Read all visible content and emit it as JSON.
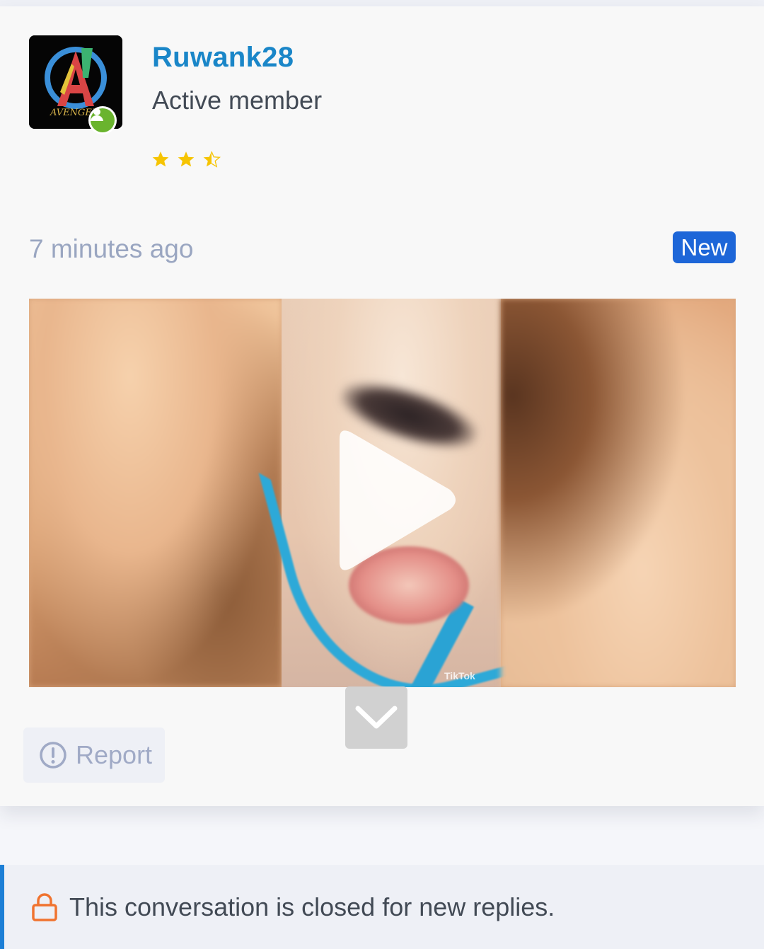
{
  "post": {
    "author": {
      "username": "Ruwank28",
      "user_title": "Active member",
      "online_icon": "user-icon",
      "rating_stars": 2.5,
      "rating_max": 3
    },
    "timestamp": "7 minutes ago",
    "badge": "New",
    "media": {
      "type": "video",
      "watermark": "TikTok",
      "play_icon": "play-icon",
      "collapse_icon": "chevron-down-icon"
    },
    "actions": {
      "report_label": "Report",
      "report_icon": "exclamation-circle-icon"
    }
  },
  "thread_notice": {
    "icon": "lock-icon",
    "message": "This conversation is closed for new replies."
  },
  "colors": {
    "username": "#1a86c8",
    "badge_bg": "#1d66d8",
    "online": "#6ab42e",
    "star": "#f6c402",
    "lock": "#f0732f",
    "notice_border": "#1d7fd6"
  }
}
